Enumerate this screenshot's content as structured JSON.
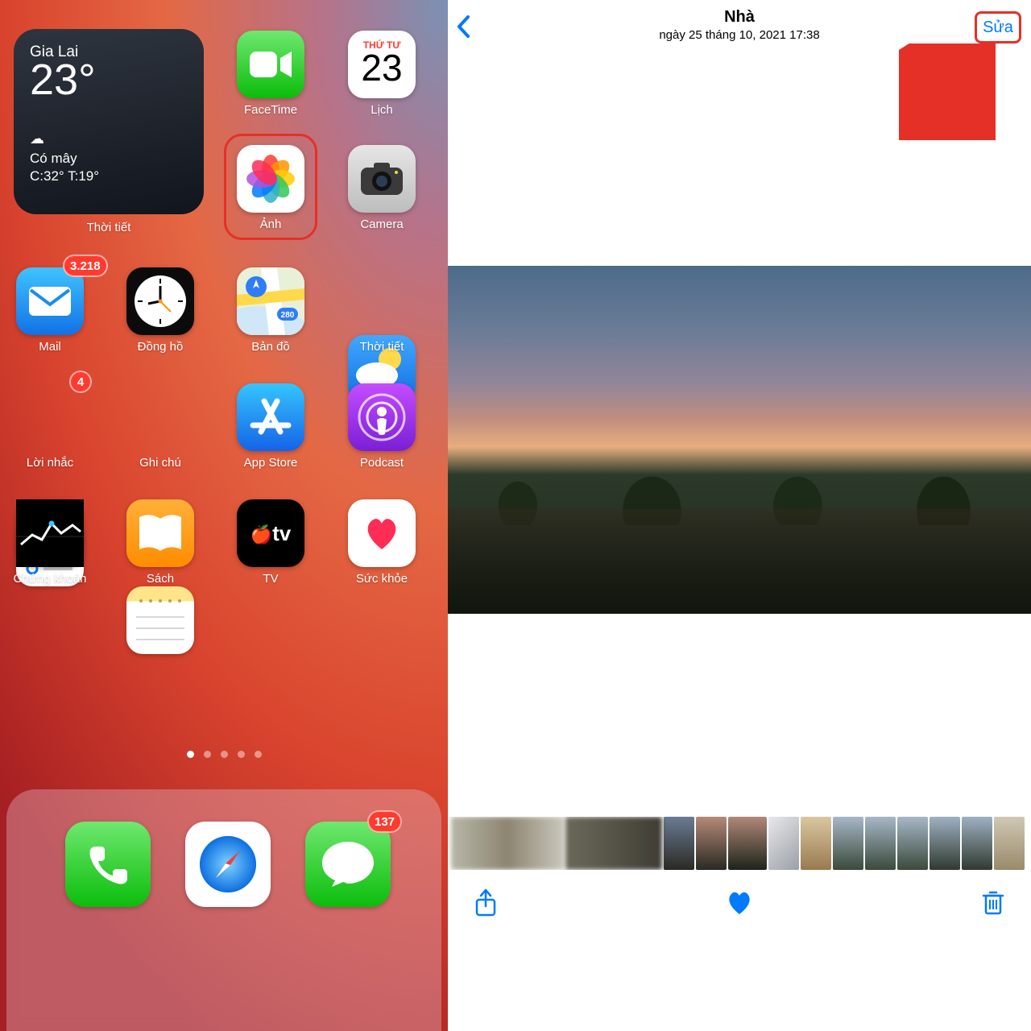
{
  "home": {
    "weather_widget": {
      "city": "Gia Lai",
      "temp": "23°",
      "cond_icon": "☁︎",
      "condition": "Có mây",
      "range": "C:32° T:19°",
      "label": "Thời tiết"
    },
    "apps": {
      "facetime": "FaceTime",
      "calendar": {
        "label": "Lịch",
        "dow": "THỨ TƯ",
        "day": "23"
      },
      "photos": "Ảnh",
      "camera": "Camera",
      "mail": {
        "label": "Mail",
        "badge": "3.218"
      },
      "clock": "Đồng hồ",
      "maps": "Bản đồ",
      "weather": "Thời tiết",
      "reminders": {
        "label": "Lời nhắc",
        "badge": "4"
      },
      "notes": "Ghi chú",
      "appstore": "App Store",
      "podcast": "Podcast",
      "stocks": "Chứng khoán",
      "books": "Sách",
      "tv": "TV",
      "tv_text": "tv",
      "health": "Sức khỏe"
    },
    "dock": {
      "messages_badge": "137"
    }
  },
  "viewer": {
    "title": "Nhà",
    "subtitle": "ngày 25 tháng 10, 2021  17:38",
    "edit": "Sửa"
  }
}
